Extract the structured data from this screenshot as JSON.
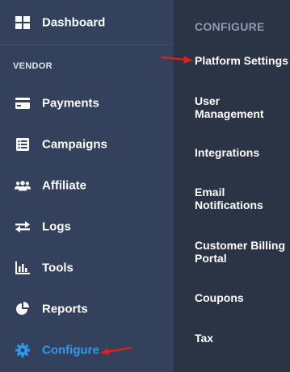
{
  "sidebar": {
    "dashboard": {
      "label": "Dashboard",
      "icon": "dashboard-grid-icon"
    },
    "section_label": "VENDOR",
    "items": [
      {
        "label": "Payments",
        "icon": "credit-card-icon"
      },
      {
        "label": "Campaigns",
        "icon": "list-icon"
      },
      {
        "label": "Affiliate",
        "icon": "users-icon"
      },
      {
        "label": "Logs",
        "icon": "exchange-arrows-icon"
      },
      {
        "label": "Tools",
        "icon": "bar-chart-icon"
      },
      {
        "label": "Reports",
        "icon": "pie-chart-icon"
      },
      {
        "label": "Configure",
        "icon": "gear-icon",
        "active": true
      }
    ]
  },
  "flyout": {
    "title": "CONFIGURE",
    "items": [
      {
        "label": "Platform Settings"
      },
      {
        "label": "User Management"
      },
      {
        "label": "Integrations"
      },
      {
        "label": "Email Notifications"
      },
      {
        "label": "Customer Billing Portal"
      },
      {
        "label": "Coupons"
      },
      {
        "label": "Tax"
      }
    ]
  },
  "colors": {
    "sidebar_bg": "#33415d",
    "flyout_bg": "#2a3444",
    "active_text": "#2e9bf0",
    "annotation_arrow": "#e0201c"
  }
}
